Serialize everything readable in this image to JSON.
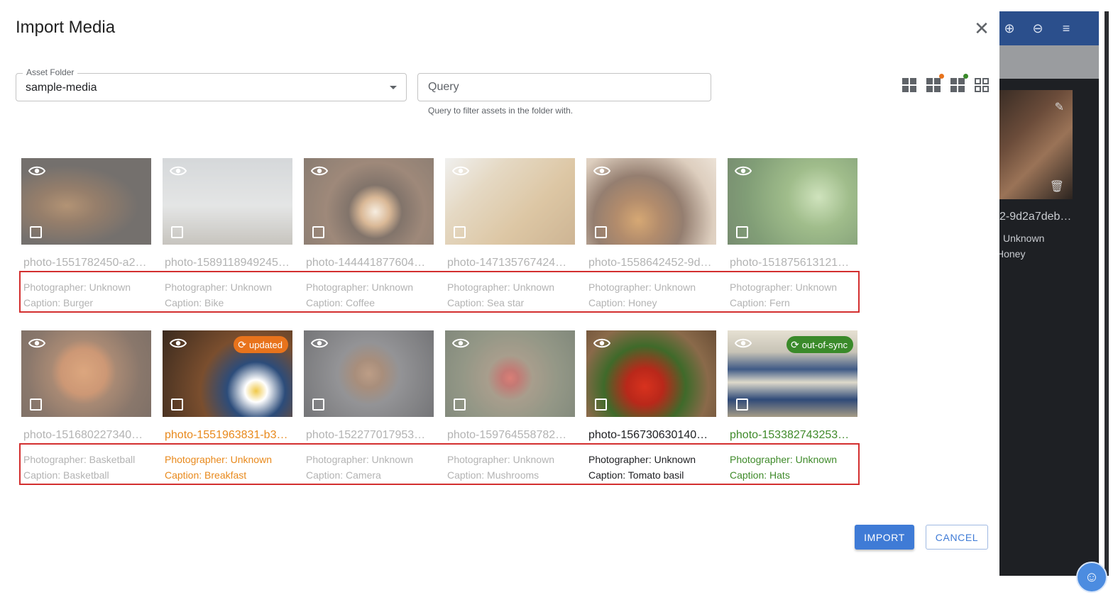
{
  "dialog": {
    "title": "Import Media",
    "asset_folder": {
      "label": "Asset Folder",
      "value": "sample-media"
    },
    "query": {
      "placeholder": "Query",
      "hint": "Query to filter assets in the folder with."
    },
    "view_toggles": [
      {
        "name": "view-large-grid-icon",
        "dot_color": ""
      },
      {
        "name": "view-grid-orange-dot-icon",
        "dot_color": "#e8731c"
      },
      {
        "name": "view-grid-green-dot-icon",
        "dot_color": "#3a8a2a"
      },
      {
        "name": "view-outline-grid-icon",
        "dot_color": ""
      }
    ],
    "items": [
      {
        "filename": "photo-1551782450-a2…",
        "photographer": "Photographer: Unknown",
        "caption": "Caption: Burger",
        "status": "muted",
        "badge": "",
        "image": "burger"
      },
      {
        "filename": "photo-1589118949245…",
        "photographer": "Photographer: Unknown",
        "caption": "Caption: Bike",
        "status": "muted",
        "badge": "",
        "image": "bike"
      },
      {
        "filename": "photo-1444418776041…",
        "photographer": "Photographer: Unknown",
        "caption": "Caption: Coffee",
        "status": "muted",
        "badge": "",
        "image": "coffee"
      },
      {
        "filename": "photo-1471357674240…",
        "photographer": "Photographer: Unknown",
        "caption": "Caption: Sea star",
        "status": "muted",
        "badge": "",
        "image": "seastar"
      },
      {
        "filename": "photo-1558642452-9d…",
        "photographer": "Photographer: Unknown",
        "caption": "Caption: Honey",
        "status": "muted",
        "badge": "",
        "image": "honey"
      },
      {
        "filename": "photo-1518756131217…",
        "photographer": "Photographer: Unknown",
        "caption": "Caption: Fern",
        "status": "muted",
        "badge": "",
        "image": "fern"
      },
      {
        "filename": "photo-1516802273409…",
        "photographer": "Photographer: Basketball",
        "caption": "Caption: Basketball",
        "status": "muted",
        "badge": "",
        "image": "basketball"
      },
      {
        "filename": "photo-1551963831-b3…",
        "photographer": "Photographer: Unknown",
        "caption": "Caption: Breakfast",
        "status": "orange",
        "badge": "updated",
        "image": "breakfast"
      },
      {
        "filename": "photo-1522770179533…",
        "photographer": "Photographer: Unknown",
        "caption": "Caption: Camera",
        "status": "muted",
        "badge": "",
        "image": "camera"
      },
      {
        "filename": "photo-1597645587822…",
        "photographer": "Photographer: Unknown",
        "caption": "Caption: Mushrooms",
        "status": "muted",
        "badge": "",
        "image": "mushroom"
      },
      {
        "filename": "photo-1567306301408…",
        "photographer": "Photographer: Unknown",
        "caption": "Caption: Tomato basil",
        "status": "black",
        "badge": "",
        "image": "tomato"
      },
      {
        "filename": "photo-1533827432537…",
        "photographer": "Photographer: Unknown",
        "caption": "Caption: Hats",
        "status": "green",
        "badge": "out-of-sync",
        "image": "hats"
      }
    ],
    "import_label": "IMPORT",
    "cancel_label": "CANCEL"
  },
  "background_panel": {
    "filename": "2-9d2a7deb…",
    "photographer": "Unknown",
    "caption": "Honey"
  },
  "colors": {
    "accent": "#3f7bd6",
    "updated": "#e8731c",
    "out_of_sync": "#3a8a2a",
    "highlight_box": "#d32f2f"
  }
}
